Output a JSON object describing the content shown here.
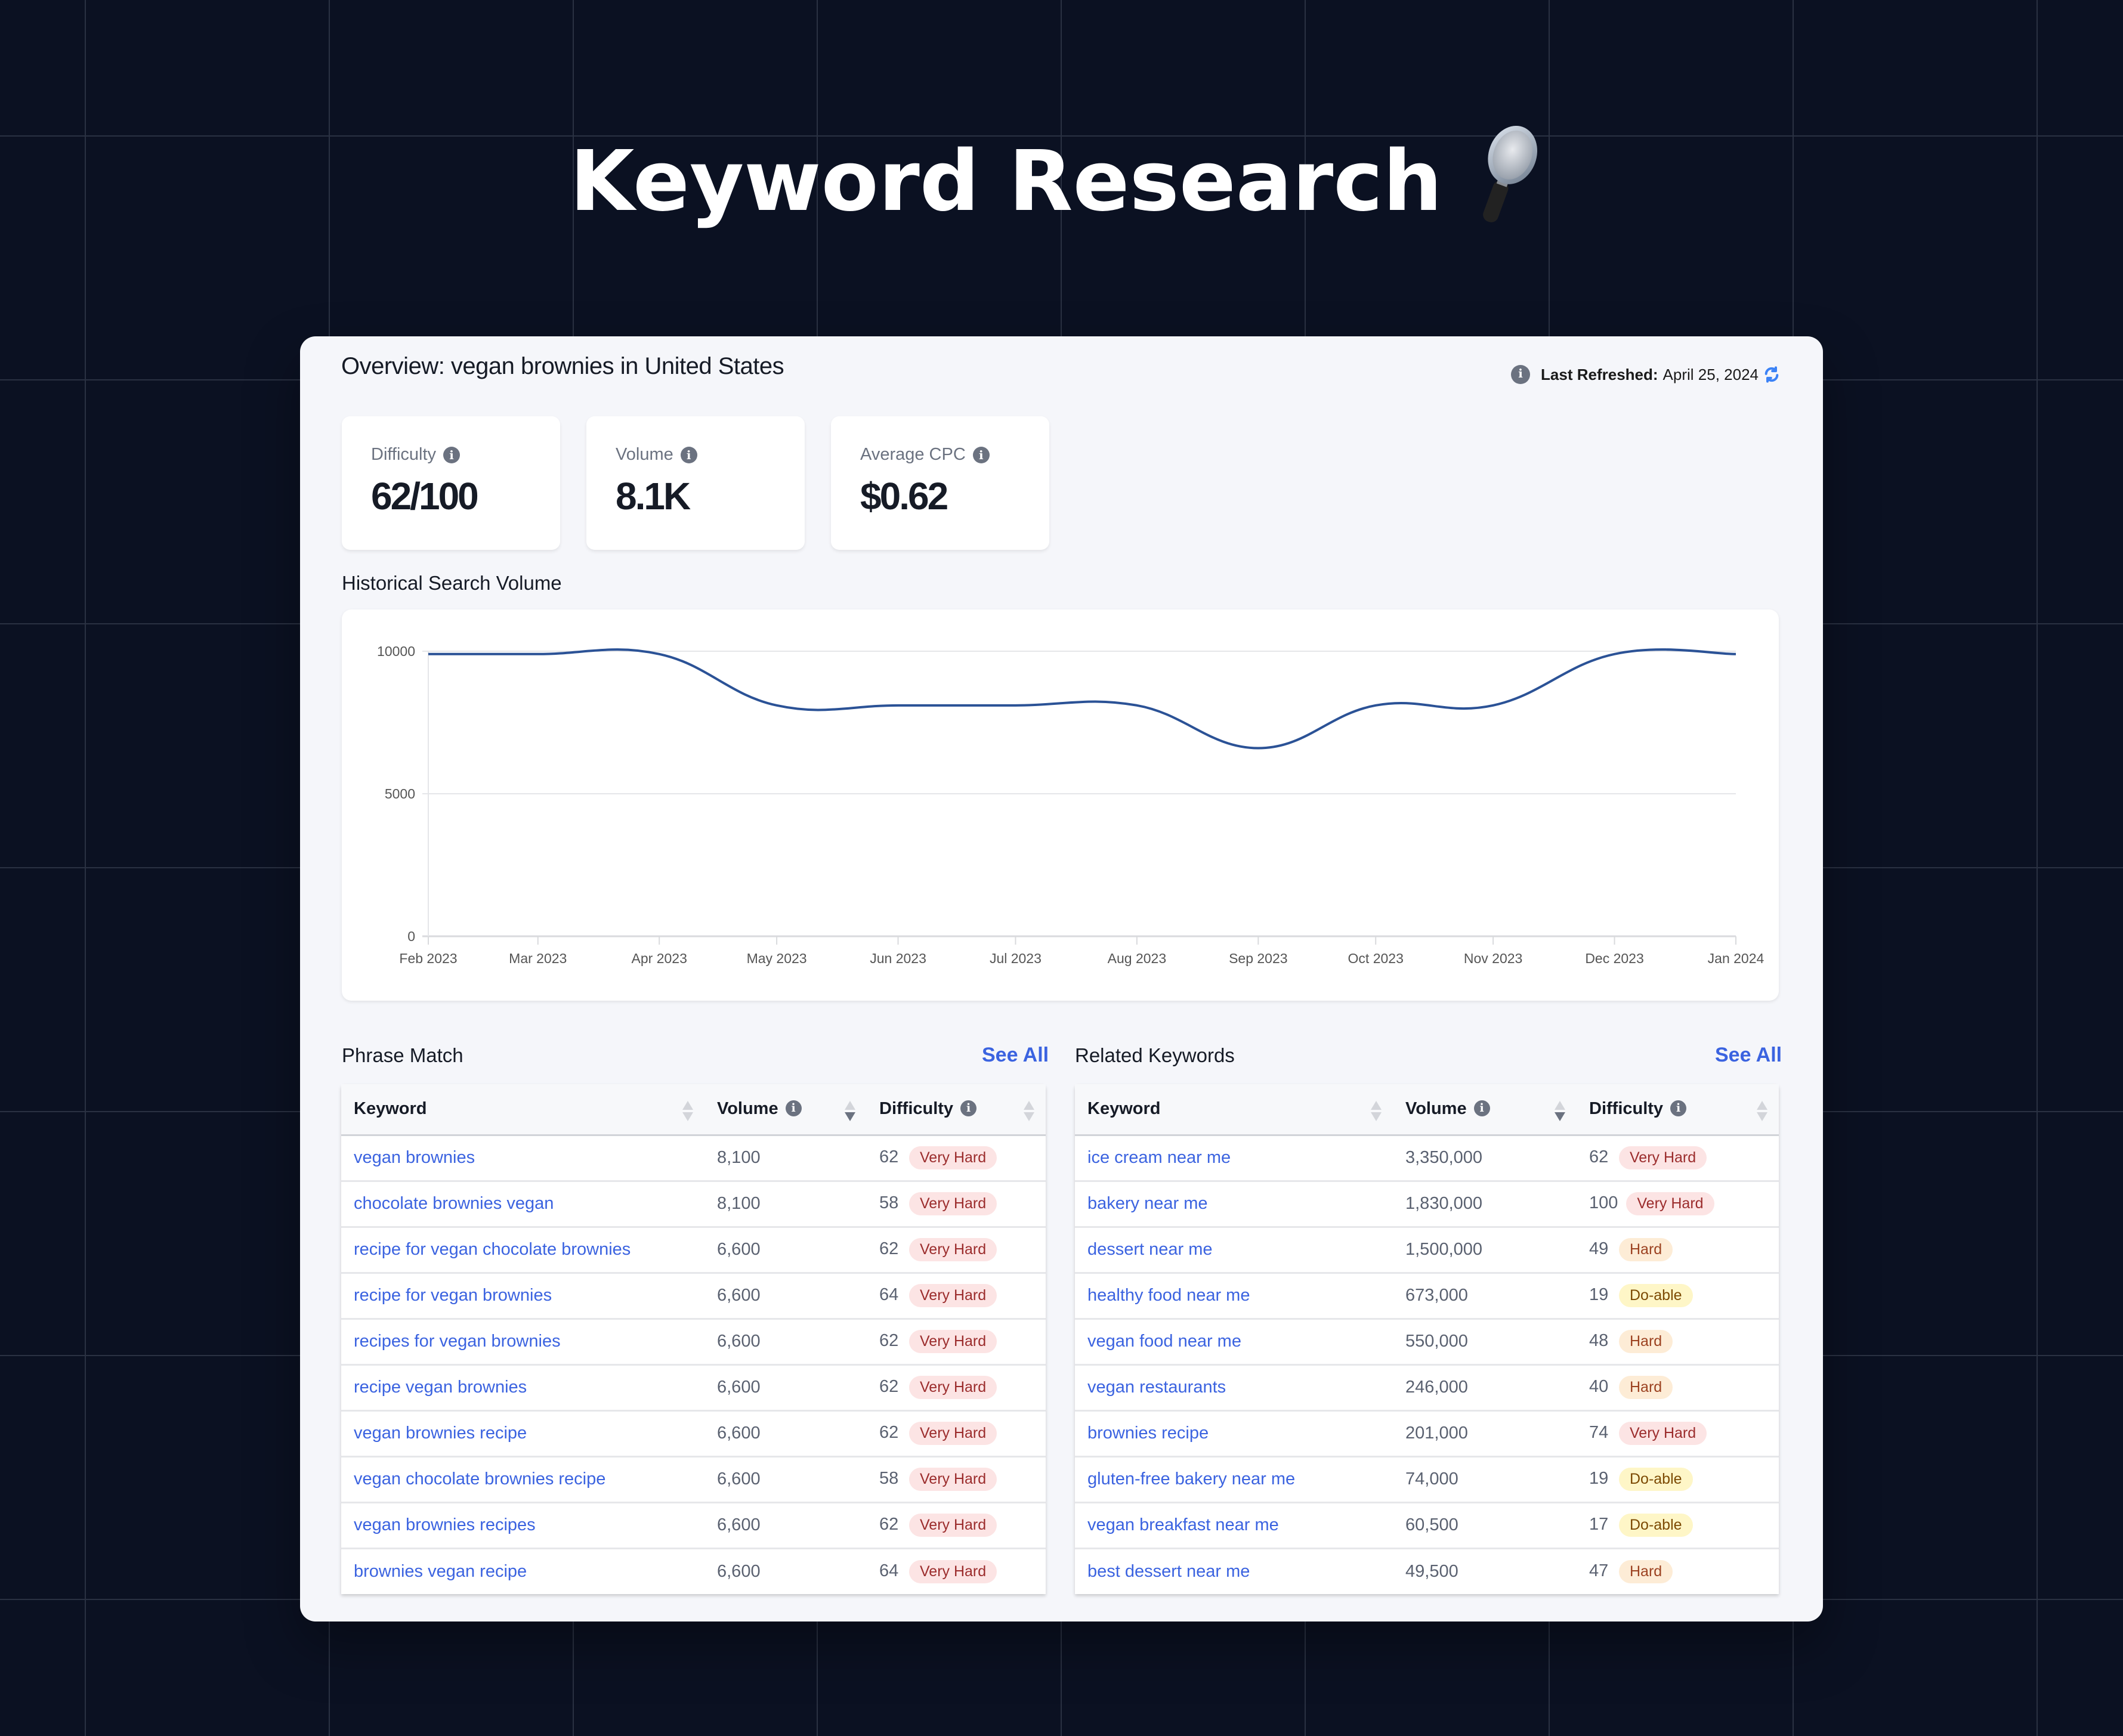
{
  "page_title": "Keyword Research",
  "title_icon": "magnifying-glass-icon",
  "overview": {
    "title": "Overview: vegan brownies in United States",
    "last_refreshed_label": "Last Refreshed:",
    "last_refreshed_date": "April 25, 2024"
  },
  "stats": [
    {
      "label": "Difficulty",
      "value": "62/100"
    },
    {
      "label": "Volume",
      "value": "8.1K"
    },
    {
      "label": "Average CPC",
      "value": "$0.62"
    }
  ],
  "historical_title": "Historical Search Volume",
  "chart_data": {
    "type": "line",
    "title": "Historical Search Volume",
    "xlabel": "",
    "ylabel": "",
    "x": [
      "2023-02-01",
      "2023-03-01",
      "2023-04-01",
      "2023-05-01",
      "2023-06-01",
      "2023-07-01",
      "2023-08-01",
      "2023-09-01",
      "2023-10-01",
      "2023-10-31",
      "2023-12-01",
      "2024-01-01"
    ],
    "x_tick_labels": [
      "Feb 2023",
      "Mar 2023",
      "Apr 2023",
      "May 2023",
      "Jun 2023",
      "Jul 2023",
      "Aug 2023",
      "Sep 2023",
      "Oct 2023",
      "Nov 2023",
      "Dec 2023",
      "Jan 2024"
    ],
    "series": [
      {
        "name": "Search Volume",
        "color": "#2b5296",
        "values": [
          9900,
          9900,
          9900,
          8100,
          8100,
          8100,
          8100,
          6600,
          8100,
          8100,
          9900,
          9900
        ]
      }
    ],
    "y_ticks": [
      0,
      5000,
      10000
    ],
    "ylim": [
      0,
      10000
    ],
    "grid": true,
    "legend": "none"
  },
  "phrase_match": {
    "title": "Phrase Match",
    "see_all": "See All",
    "columns": [
      "Keyword",
      "Volume",
      "Difficulty"
    ],
    "sorted_column": "Volume",
    "sort_direction": "descending",
    "rows": [
      {
        "keyword": "vegan brownies",
        "volume": "8,100",
        "difficulty": "62",
        "level": "Very Hard"
      },
      {
        "keyword": "chocolate brownies vegan",
        "volume": "8,100",
        "difficulty": "58",
        "level": "Very Hard"
      },
      {
        "keyword": "recipe for vegan chocolate brownies",
        "volume": "6,600",
        "difficulty": "62",
        "level": "Very Hard"
      },
      {
        "keyword": "recipe for vegan brownies",
        "volume": "6,600",
        "difficulty": "64",
        "level": "Very Hard"
      },
      {
        "keyword": "recipes for vegan brownies",
        "volume": "6,600",
        "difficulty": "62",
        "level": "Very Hard"
      },
      {
        "keyword": "recipe vegan brownies",
        "volume": "6,600",
        "difficulty": "62",
        "level": "Very Hard"
      },
      {
        "keyword": "vegan brownies recipe",
        "volume": "6,600",
        "difficulty": "62",
        "level": "Very Hard"
      },
      {
        "keyword": "vegan chocolate brownies recipe",
        "volume": "6,600",
        "difficulty": "58",
        "level": "Very Hard"
      },
      {
        "keyword": "vegan brownies recipes",
        "volume": "6,600",
        "difficulty": "62",
        "level": "Very Hard"
      },
      {
        "keyword": "brownies vegan recipe",
        "volume": "6,600",
        "difficulty": "64",
        "level": "Very Hard"
      }
    ]
  },
  "related_keywords": {
    "title": "Related Keywords",
    "see_all": "See All",
    "columns": [
      "Keyword",
      "Volume",
      "Difficulty"
    ],
    "sorted_column": "Volume",
    "sort_direction": "descending",
    "rows": [
      {
        "keyword": "ice cream near me",
        "volume": "3,350,000",
        "difficulty": "62",
        "level": "Very Hard"
      },
      {
        "keyword": "bakery near me",
        "volume": "1,830,000",
        "difficulty": "100",
        "level": "Very Hard"
      },
      {
        "keyword": "dessert near me",
        "volume": "1,500,000",
        "difficulty": "49",
        "level": "Hard"
      },
      {
        "keyword": "healthy food near me",
        "volume": "673,000",
        "difficulty": "19",
        "level": "Do-able"
      },
      {
        "keyword": "vegan food near me",
        "volume": "550,000",
        "difficulty": "48",
        "level": "Hard"
      },
      {
        "keyword": "vegan restaurants",
        "volume": "246,000",
        "difficulty": "40",
        "level": "Hard"
      },
      {
        "keyword": "brownies recipe",
        "volume": "201,000",
        "difficulty": "74",
        "level": "Very Hard"
      },
      {
        "keyword": "gluten-free bakery near me",
        "volume": "74,000",
        "difficulty": "19",
        "level": "Do-able"
      },
      {
        "keyword": "vegan breakfast near me",
        "volume": "60,500",
        "difficulty": "17",
        "level": "Do-able"
      },
      {
        "keyword": "best dessert near me",
        "volume": "49,500",
        "difficulty": "47",
        "level": "Hard"
      }
    ]
  },
  "colors": {
    "background": "#0b1122",
    "link": "#3b63e0",
    "line": "#2b5296",
    "very_hard_bg": "#fce4e4",
    "very_hard_text": "#9b2c2c",
    "hard_bg": "#fdecd6",
    "hard_text": "#9c4221",
    "doable_bg": "#fef6c7",
    "doable_text": "#7c4a03",
    "refresh_icon": "#3b82f6"
  }
}
